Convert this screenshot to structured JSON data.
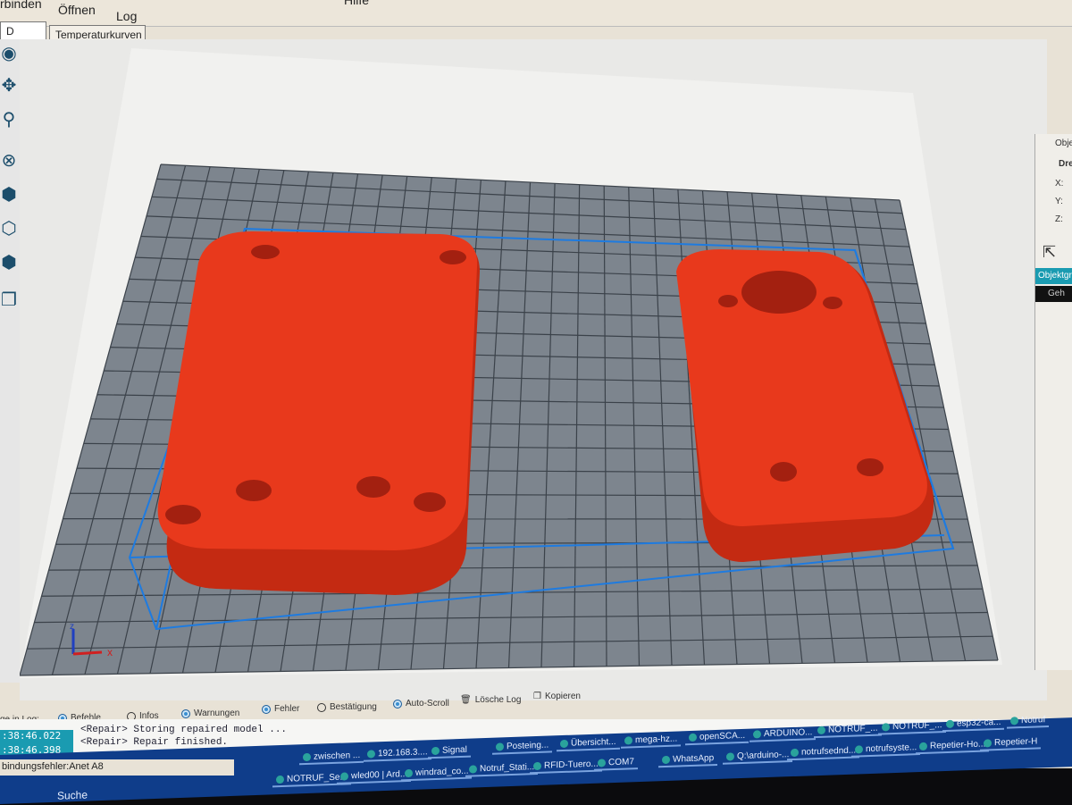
{
  "toolbar": {
    "connect": "rbinden",
    "open": "Öffnen",
    "log": "Log",
    "help": "Hilfe"
  },
  "tabs": [
    "D Ansicht",
    "Temperaturkurven"
  ],
  "right_panel": {
    "title": "Objekt",
    "rotate": "Dreh",
    "x": "X:",
    "y": "Y:",
    "z": "Z:",
    "objects_tab": "Objektgr",
    "item": "Geh"
  },
  "axes": {
    "x": "x",
    "z": "z"
  },
  "log_options": {
    "label": "ge in Log:",
    "items": [
      {
        "label": "Befehle",
        "checked": true
      },
      {
        "label": "Infos",
        "checked": false
      },
      {
        "label": "Warnungen",
        "checked": true
      },
      {
        "label": "Fehler",
        "checked": true
      },
      {
        "label": "Bestätigung",
        "checked": false
      },
      {
        "label": "Auto-Scroll",
        "checked": true
      }
    ],
    "clear": "Lösche Log",
    "copy": "Kopieren"
  },
  "log": [
    {
      "time": ":38:46.022",
      "msg": "<Repair> Storing repaired model ..."
    },
    {
      "time": ":38:46.398",
      "msg": "<Repair> Repair finished."
    }
  ],
  "status": "bindungsfehler:Anet A8",
  "taskbar": {
    "search": "Suche",
    "row1": [
      "zwischen ...",
      "192.168.3....",
      "Signal",
      "Posteing...",
      "Übersicht...",
      "mega-hz...",
      "openSCA...",
      "ARDUINO...",
      "NOTRUF_...",
      "NOTRUF_...",
      "esp32-ca...",
      "Notruf"
    ],
    "row2": [
      "NOTRUF_Se...",
      "wled00 | Ard...",
      "windrad_co...",
      "Notruf_Stati...",
      "RFID-Tuero...",
      "COM7",
      "WhatsApp",
      "Q:\\arduino-...",
      "notrufsednd...",
      "notrufsyste...",
      "Repetier-Ho...",
      "Repetier-H"
    ]
  },
  "colors": {
    "part": "#e8391c",
    "grid": "#7d858e",
    "bbox": "#1e7be0",
    "accent": "#1a9bb1"
  }
}
